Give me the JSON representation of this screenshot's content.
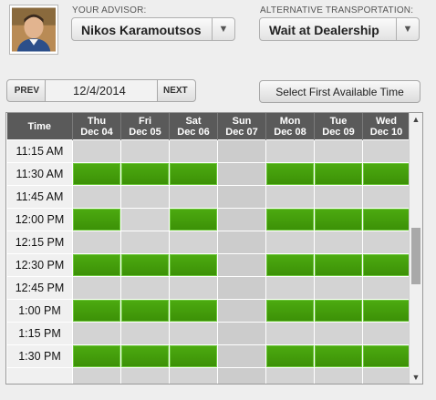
{
  "advisor": {
    "label": "YOUR ADVISOR:",
    "selected": "Nikos Karamoutsos"
  },
  "transport": {
    "label": "ALTERNATIVE TRANSPORTATION:",
    "selected": "Wait at Dealership"
  },
  "pager": {
    "prev": "PREV",
    "date": "12/4/2014",
    "next": "NEXT"
  },
  "first_available_label": "Select First Available Time",
  "schedule": {
    "time_header": "Time",
    "days": [
      {
        "dow": "Thu",
        "date": "Dec 04"
      },
      {
        "dow": "Fri",
        "date": "Dec 05"
      },
      {
        "dow": "Sat",
        "date": "Dec 06"
      },
      {
        "dow": "Sun",
        "date": "Dec 07"
      },
      {
        "dow": "Mon",
        "date": "Dec 08"
      },
      {
        "dow": "Tue",
        "date": "Dec 09"
      },
      {
        "dow": "Wed",
        "date": "Dec 10"
      }
    ],
    "rows": [
      {
        "time": "11:15 AM",
        "avail": [
          false,
          false,
          false,
          false,
          false,
          false,
          false
        ]
      },
      {
        "time": "11:30 AM",
        "avail": [
          true,
          true,
          true,
          false,
          true,
          true,
          true
        ]
      },
      {
        "time": "11:45 AM",
        "avail": [
          false,
          false,
          false,
          false,
          false,
          false,
          false
        ]
      },
      {
        "time": "12:00 PM",
        "avail": [
          true,
          false,
          true,
          false,
          true,
          true,
          true
        ]
      },
      {
        "time": "12:15 PM",
        "avail": [
          false,
          false,
          false,
          false,
          false,
          false,
          false
        ]
      },
      {
        "time": "12:30 PM",
        "avail": [
          true,
          true,
          true,
          false,
          true,
          true,
          true
        ]
      },
      {
        "time": "12:45 PM",
        "avail": [
          false,
          false,
          false,
          false,
          false,
          false,
          false
        ]
      },
      {
        "time": "1:00 PM",
        "avail": [
          true,
          true,
          true,
          false,
          true,
          true,
          true
        ]
      },
      {
        "time": "1:15 PM",
        "avail": [
          false,
          false,
          false,
          false,
          false,
          false,
          false
        ]
      },
      {
        "time": "1:30 PM",
        "avail": [
          true,
          true,
          true,
          false,
          true,
          true,
          true
        ]
      },
      {
        "time": "",
        "avail": [
          false,
          false,
          false,
          false,
          false,
          false,
          false
        ]
      }
    ]
  },
  "icons": {
    "dropdown": "chevron-down-icon",
    "scroll_up": "scroll-up-arrow-icon",
    "scroll_down": "scroll-down-arrow-icon"
  },
  "colors": {
    "available": "#44a00c",
    "unavailable": "#d3d3d3",
    "header": "#5a5a5a"
  }
}
